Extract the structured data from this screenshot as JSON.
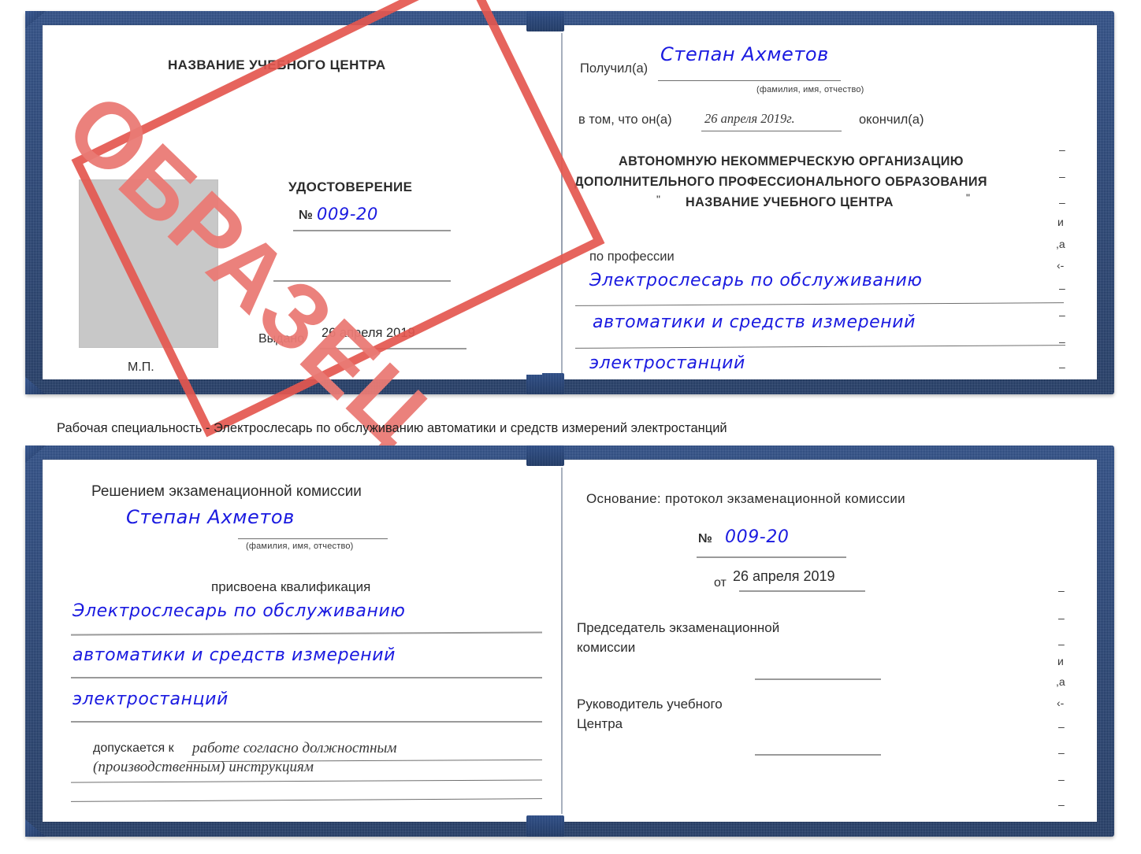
{
  "document": {
    "type": "certificate-sample",
    "watermark": "ОБРАЗЕЦ",
    "caption": "Рабочая специальность - Электрослесарь по обслуживанию автоматики и средств измерений электростанций",
    "colors": {
      "cover_blue": "#234175",
      "watermark_red": "#e4574f",
      "handwriting_blue": "#1a1ae0",
      "photo_placeholder_gray": "#c8c8c8"
    }
  },
  "top_spread": {
    "left_page": {
      "center_name": "НАЗВАНИЕ УЧЕБНОГО ЦЕНТРА",
      "title": "УДОСТОВЕРЕНИЕ",
      "number_label": "№",
      "number_value": "009-20",
      "issued_label": "Выдано",
      "issued_value": "26 апреля 2019",
      "seal_label": "М.П.",
      "photo_placeholder": "photo-area"
    },
    "right_page": {
      "received_label": "Получил(а)",
      "received_value": "Степан Ахметов",
      "fio_hint": "(фамилия, имя, отчество)",
      "that_he_label": "в том, что он(а)",
      "completion_date": "26 апреля 2019г.",
      "finished_label": "окончил(а)",
      "org_line_1": "АВТОНОМНУЮ НЕКОММЕРЧЕСКУЮ ОРГАНИЗАЦИЮ",
      "org_line_2": "ДОПОЛНИТЕЛЬНОГО ПРОФЕССИОНАЛЬНОГО ОБРАЗОВАНИЯ",
      "org_quote_open": "\"",
      "org_line_3": "НАЗВАНИЕ УЧЕБНОГО ЦЕНТРА",
      "org_quote_close": "\"",
      "profession_label": "по профессии",
      "profession_line_1": "Электрослесарь по обслуживанию",
      "profession_line_2": "автоматики и средств измерений",
      "profession_line_3": "электростанций",
      "margin_fragments": [
        "–",
        "–",
        "–",
        "и",
        ",а",
        "‹-",
        "–",
        "–",
        "–",
        "–"
      ]
    }
  },
  "bottom_spread": {
    "left_page": {
      "heading": "Решением экзаменационной комиссии",
      "name_value": "Степан Ахметов",
      "fio_hint": "(фамилия, имя, отчество)",
      "qualification_label": "присвоена квалификация",
      "qualification_line_1": "Электрослесарь по обслуживанию",
      "qualification_line_2": "автоматики и средств измерений",
      "qualification_line_3": "электростанций",
      "admitted_label": "допускается к",
      "admitted_value_1": "работе согласно должностным",
      "admitted_value_2": "(производственным) инструкциям"
    },
    "right_page": {
      "basis_label": "Основание: протокол экзаменационной комиссии",
      "number_label": "№",
      "number_value": "009-20",
      "from_label": "от",
      "from_value": "26 апреля 2019",
      "chairman_line_1": "Председатель экзаменационной",
      "chairman_line_2": "комиссии",
      "head_line_1": "Руководитель учебного",
      "head_line_2": "Центра",
      "margin_fragments": [
        "–",
        "–",
        "–",
        "и",
        ",а",
        "‹-",
        "–",
        "–",
        "–",
        "–"
      ]
    }
  }
}
